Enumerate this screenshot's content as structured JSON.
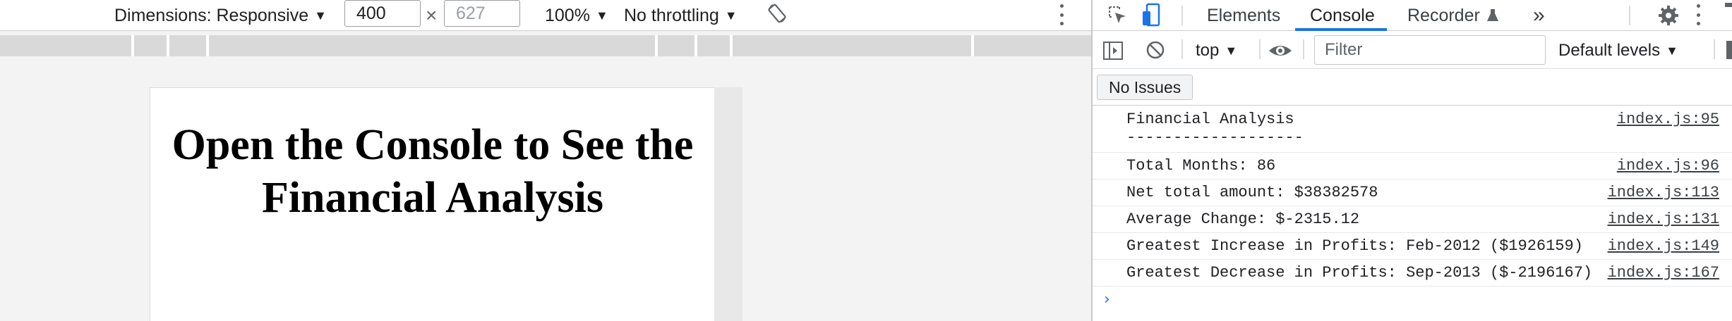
{
  "device_toolbar": {
    "dimensions_label": "Dimensions: Responsive",
    "width_value": "400",
    "times_symbol": "×",
    "height_placeholder": "627",
    "zoom": "100%",
    "throttling": "No throttling",
    "rotate_icon": "rotate-icon",
    "more_icon": "kebab-icon"
  },
  "page": {
    "heading": "Open the Console to See the Financial Analysis"
  },
  "devtools": {
    "tabs": [
      "Elements",
      "Console",
      "Recorder"
    ],
    "active_tab": "Console",
    "overflow_label": "»",
    "console_toolbar": {
      "context": "top",
      "filter_placeholder": "Filter",
      "levels": "Default levels"
    },
    "issues_label": "No Issues",
    "messages": [
      {
        "text": "Financial Analysis\n-------------------",
        "source": "index.js:95"
      },
      {
        "text": "Total Months: 86",
        "source": "index.js:96"
      },
      {
        "text": "Net total amount: $38382578",
        "source": "index.js:113"
      },
      {
        "text": "Average Change: $-2315.12",
        "source": "index.js:131"
      },
      {
        "text": "Greatest Increase in Profits: Feb-2012 ($1926159)",
        "source": "index.js:149"
      },
      {
        "text": "Greatest Decrease in Profits: Sep-2013 ($-2196167)",
        "source": "index.js:167"
      }
    ],
    "prompt": "›"
  },
  "colors": {
    "accent": "#1a73e8"
  }
}
